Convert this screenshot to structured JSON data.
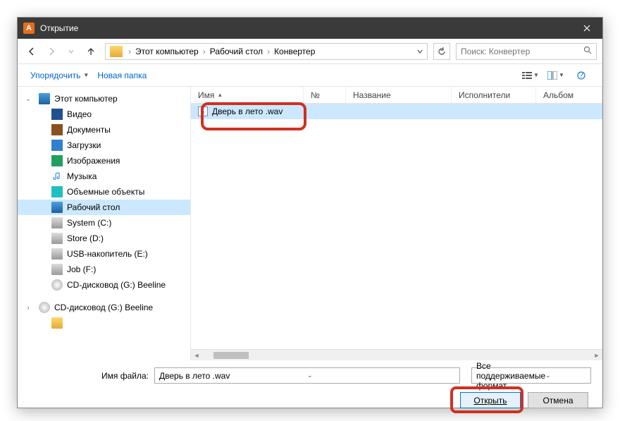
{
  "title": "Открытие",
  "nav": {
    "crumbs": [
      "Этот компьютер",
      "Рабочий стол",
      "Конвертер"
    ],
    "search_placeholder": "Поиск: Конвертер"
  },
  "toolbar": {
    "organize": "Упорядочить",
    "newfolder": "Новая папка"
  },
  "columns": {
    "name": "Имя",
    "num": "№",
    "title": "Название",
    "artists": "Исполнители",
    "album": "Альбом"
  },
  "tree": {
    "pc": "Этот компьютер",
    "video": "Видео",
    "docs": "Документы",
    "downloads": "Загрузки",
    "images": "Изображения",
    "music": "Музыка",
    "objects3d": "Объемные объекты",
    "desktop": "Рабочий стол",
    "system": "System (C:)",
    "store": "Store (D:)",
    "usb": "USB-накопитель (E:)",
    "job": "Job (F:)",
    "cd1": "CD-дисковод (G:) Beeline",
    "cd2": "CD-дисковод (G:) Beeline"
  },
  "files": {
    "row0": "Дверь в лето .wav"
  },
  "bottom": {
    "label": "Имя файла:",
    "filename": "Дверь в лето .wav",
    "filter": "Все поддерживаемые формат",
    "open": "Открыть",
    "cancel": "Отмена"
  }
}
